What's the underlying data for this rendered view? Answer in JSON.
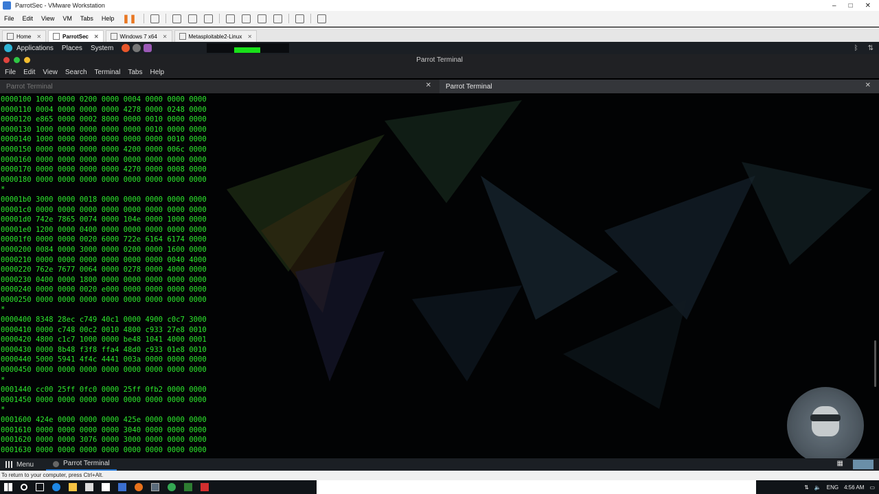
{
  "vmware": {
    "title": "ParrotSec - VMware Workstation",
    "menu": [
      "File",
      "Edit",
      "View",
      "VM",
      "Tabs",
      "Help"
    ],
    "tabs": [
      {
        "label": "Home",
        "active": false
      },
      {
        "label": "ParrotSec",
        "active": true
      },
      {
        "label": "Windows 7 x64",
        "active": false
      },
      {
        "label": "Metasploitable2-Linux",
        "active": false
      }
    ],
    "status": "To return to your computer, press Ctrl+Alt."
  },
  "parrot_panel": {
    "menus": [
      "Applications",
      "Places",
      "System"
    ]
  },
  "terminal": {
    "window_title": "Parrot Terminal",
    "menu": [
      "File",
      "Edit",
      "View",
      "Search",
      "Terminal",
      "Tabs",
      "Help"
    ],
    "tabs": [
      {
        "label": "Parrot Terminal",
        "active": false
      },
      {
        "label": "Parrot Terminal",
        "active": true
      }
    ],
    "lines": [
      "0000100 1000 0000 0200 0000 0004 0000 0000 0000",
      "0000110 0004 0000 0000 0000 4278 0000 0248 0000",
      "0000120 e865 0000 0002 8000 0000 0010 0000 0000",
      "0000130 1000 0000 0000 0000 0000 0010 0000 0000",
      "0000140 1000 0000 0000 0000 0000 0000 0010 0000",
      "0000150 0000 0000 0000 0000 4200 0000 006c 0000",
      "0000160 0000 0000 0000 0000 0000 0000 0000 0000",
      "0000170 0000 0000 0000 0000 4270 0000 0008 0000",
      "0000180 0000 0000 0000 0000 0000 0000 0000 0000",
      "*",
      "00001b0 3000 0000 0018 0000 0000 0000 0000 0000",
      "00001c0 0000 0000 0000 0000 0000 0000 0000 0000",
      "00001d0 742e 7865 0074 0000 104e 0000 1000 0000",
      "00001e0 1200 0000 0400 0000 0000 0000 0000 0000",
      "00001f0 0000 0000 0020 6000 722e 6164 6174 0000",
      "0000200 0084 0000 3000 0000 0200 0000 1600 0000",
      "0000210 0000 0000 0000 0000 0000 0000 0040 4000",
      "0000220 762e 7677 0064 0000 0278 0000 4000 0000",
      "0000230 0400 0000 1800 0000 0000 0000 0000 0000",
      "0000240 0000 0000 0020 e000 0000 0000 0000 0000",
      "0000250 0000 0000 0000 0000 0000 0000 0000 0000",
      "*",
      "0000400 8348 28ec c749 40c1 0000 4900 c0c7 3000",
      "0000410 0000 c748 00c2 0010 4800 c933 27e8 0010",
      "0000420 4800 c1c7 1000 0000 be48 1041 4000 0001",
      "0000430 0000 8b48 f3f8 ffa4 48d0 c933 01e8 0010",
      "0000440 5000 5941 4f4c 4441 003a 0000 0000 0000",
      "0000450 0000 0000 0000 0000 0000 0000 0000 0000",
      "*",
      "0001440 cc00 25ff 0fc0 0000 25ff 0fb2 0000 0000",
      "0001450 0000 0000 0000 0000 0000 0000 0000 0000",
      "*",
      "0001600 424e 0000 0000 0000 425e 0000 0000 0000",
      "0001610 0000 0000 0000 0000 3040 0000 0000 0000",
      "0001620 0000 0000 3076 0000 3000 0000 0000 0000",
      "0001630 0000 0000 0000 0000 0000 0000 0000 0000"
    ]
  },
  "parrot_bottom": {
    "menu_label": "Menu",
    "task_label": "Parrot Terminal"
  },
  "windows": {
    "lang": "ENG",
    "time": "4:56 AM"
  }
}
